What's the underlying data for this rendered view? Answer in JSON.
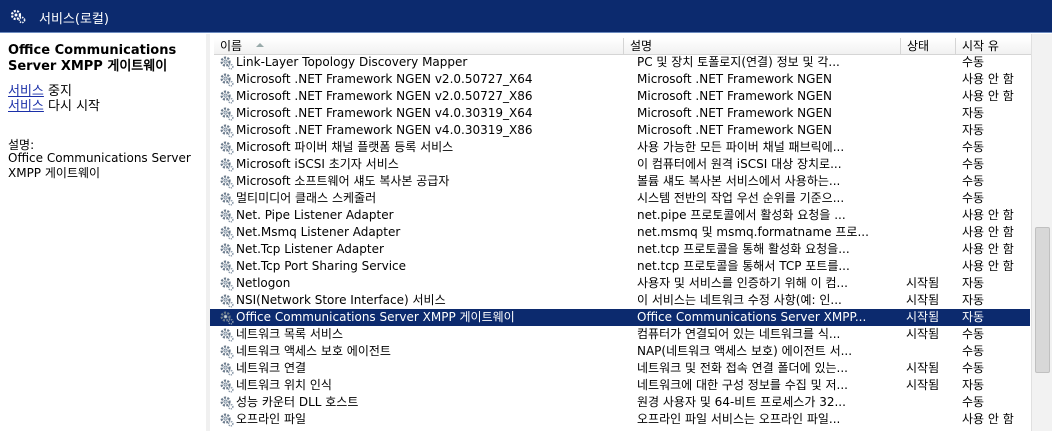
{
  "window": {
    "title": "서비스(로컬)"
  },
  "left_panel": {
    "service_name": "Office Communications Server XMPP 게이트웨이",
    "actions": [
      {
        "link": "서비스",
        "suffix": " 중지"
      },
      {
        "link": "서비스",
        "suffix": " 다시 시작"
      }
    ],
    "description_label": "설명:",
    "description": "Office Communications Server XMPP 게이트웨이"
  },
  "columns": [
    "이름",
    "설명",
    "상태",
    "시작 유"
  ],
  "rows": [
    {
      "name": "Link-Layer Topology Discovery Mapper",
      "desc": "PC 및 장치 토폴로지(연결) 정보 및 각...",
      "status": "",
      "startup": "수동"
    },
    {
      "name": "Microsoft .NET Framework NGEN v2.0.50727_X64",
      "desc": "Microsoft .NET Framework NGEN",
      "status": "",
      "startup": "사용 안 함"
    },
    {
      "name": "Microsoft .NET Framework NGEN v2.0.50727_X86",
      "desc": "Microsoft .NET Framework NGEN",
      "status": "",
      "startup": "사용 안 함"
    },
    {
      "name": "Microsoft .NET Framework NGEN v4.0.30319_X64",
      "desc": "Microsoft .NET Framework NGEN",
      "status": "",
      "startup": "자동"
    },
    {
      "name": "Microsoft .NET Framework NGEN v4.0.30319_X86",
      "desc": "Microsoft .NET Framework NGEN",
      "status": "",
      "startup": "자동"
    },
    {
      "name": "Microsoft 파이버 채널 플랫폼 등록 서비스",
      "desc": "사용 가능한 모든 파이버 채널 패브릭에...",
      "status": "",
      "startup": "수동"
    },
    {
      "name": "Microsoft iSCSI 초기자 서비스",
      "desc": "이 컴퓨터에서 원격 iSCSI 대상 장치로...",
      "status": "",
      "startup": "수동"
    },
    {
      "name": "Microsoft 소프트웨어 섀도 복사본 공급자",
      "desc": "볼륨 섀도 복사본 서비스에서 사용하는...",
      "status": "",
      "startup": "수동"
    },
    {
      "name": "멀티미디어 클래스 스케줄러",
      "desc": "시스템 전반의 작업 우선 순위를 기준으...",
      "status": "",
      "startup": "수동"
    },
    {
      "name": "Net. Pipe Listener Adapter",
      "desc": "net.pipe 프로토콜에서 활성화 요청을 ...",
      "status": "",
      "startup": "사용 안 함"
    },
    {
      "name": "Net.Msmq Listener Adapter",
      "desc": "net.msmq 및 msmq.formatname 프로...",
      "status": "",
      "startup": "사용 안 함"
    },
    {
      "name": "Net.Tcp Listener Adapter",
      "desc": "net.tcp 프로토콜을 통해 활성화 요청을...",
      "status": "",
      "startup": "사용 안 함"
    },
    {
      "name": "Net.Tcp Port Sharing Service",
      "desc": "net.tcp 프로토콜을 통해서 TCP 포트를...",
      "status": "",
      "startup": "사용 안 함"
    },
    {
      "name": "Netlogon",
      "desc": "사용자 및 서비스를 인증하기 위해 이 컴...",
      "status": "시작됨",
      "startup": "자동"
    },
    {
      "name": "NSI(Network Store Interface) 서비스",
      "desc": "이 서비스는 네트워크 수정 사항(예: 인...",
      "status": "시작됨",
      "startup": "자동"
    },
    {
      "name": "Office Communications Server XMPP 게이트웨이",
      "desc": "Office Communications Server XMPP...",
      "status": "시작됨",
      "startup": "자동",
      "selected": true
    },
    {
      "name": "네트워크 목록 서비스",
      "desc": "컴퓨터가 연결되어 있는 네트워크를 식...",
      "status": "시작됨",
      "startup": "수동"
    },
    {
      "name": "네트워크 액세스 보호 에이전트",
      "desc": "NAP(네트워크 액세스 보호) 에이전트 서...",
      "status": "",
      "startup": "수동"
    },
    {
      "name": "네트워크 연결",
      "desc": "네트워크 및 전화 접속 연결 폴더에 있는...",
      "status": "시작됨",
      "startup": "수동"
    },
    {
      "name": "네트워크 위치 인식",
      "desc": "네트워크에 대한 구성 정보를 수집 및 저...",
      "status": "시작됨",
      "startup": "자동"
    },
    {
      "name": "성능 카운터 DLL 호스트",
      "desc": "원경 사용자 및 64-비트 프로세스가 32...",
      "status": "",
      "startup": "수동"
    },
    {
      "name": "오프라인 파일",
      "desc": "오프라인 파일 서비스는 오프라인 파일...",
      "status": "",
      "startup": "사용 안 함"
    }
  ]
}
